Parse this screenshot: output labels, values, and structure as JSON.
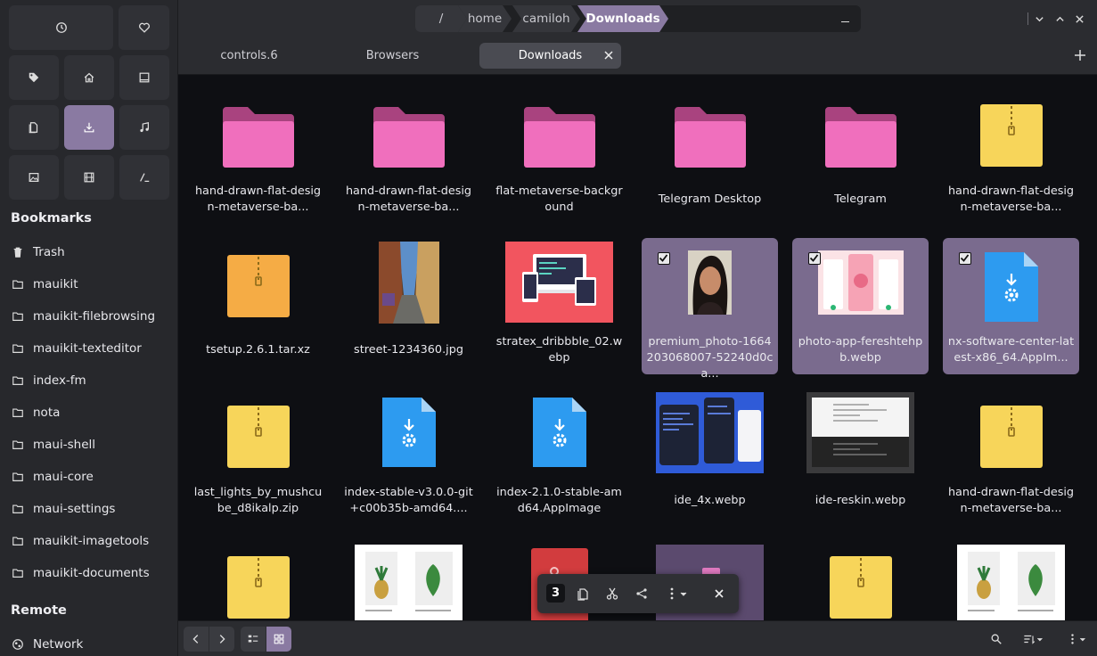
{
  "sidebar": {
    "quick_places": [
      {
        "icon": "clock-icon",
        "name": "recent"
      },
      {
        "icon": "heart-icon",
        "name": "favorites"
      },
      {
        "icon": "tag-icon",
        "name": "tags"
      },
      {
        "icon": "home-icon",
        "name": "home"
      },
      {
        "icon": "desktop-icon",
        "name": "desktop"
      },
      {
        "icon": "documents-icon",
        "name": "documents"
      },
      {
        "icon": "downloads-icon",
        "name": "downloads",
        "active": true
      },
      {
        "icon": "music-icon",
        "name": "music"
      },
      {
        "icon": "pictures-icon",
        "name": "pictures"
      },
      {
        "icon": "videos-icon",
        "name": "videos"
      },
      {
        "icon": "root-icon",
        "name": "root"
      }
    ],
    "bookmarks_title": "Bookmarks",
    "bookmarks": [
      {
        "label": "Trash",
        "icon": "trash-icon"
      },
      {
        "label": "mauikit",
        "icon": "folder-icon"
      },
      {
        "label": "mauikit-filebrowsing",
        "icon": "folder-icon"
      },
      {
        "label": "mauikit-texteditor",
        "icon": "folder-icon"
      },
      {
        "label": "index-fm",
        "icon": "folder-icon"
      },
      {
        "label": "nota",
        "icon": "folder-icon"
      },
      {
        "label": "maui-shell",
        "icon": "folder-icon"
      },
      {
        "label": "maui-core",
        "icon": "folder-icon"
      },
      {
        "label": "maui-settings",
        "icon": "folder-icon"
      },
      {
        "label": "mauikit-imagetools",
        "icon": "folder-icon"
      },
      {
        "label": "mauikit-documents",
        "icon": "folder-icon"
      }
    ],
    "remote_title": "Remote",
    "remote": [
      {
        "label": "Network",
        "icon": "network-icon"
      }
    ]
  },
  "pathbar": {
    "crumbs": [
      "/",
      "home",
      "camiloh",
      "Downloads"
    ]
  },
  "tabs": {
    "items": [
      {
        "label": "controls.6"
      },
      {
        "label": "Browsers"
      },
      {
        "label": "Downloads",
        "active": true
      }
    ]
  },
  "files": [
    {
      "label": "hand-drawn-flat-design-metaverse-ba...",
      "kind": "folder"
    },
    {
      "label": "hand-drawn-flat-design-metaverse-ba...",
      "kind": "folder"
    },
    {
      "label": "flat-metaverse-background",
      "kind": "folder"
    },
    {
      "label": "Telegram Desktop",
      "kind": "folder"
    },
    {
      "label": "Telegram",
      "kind": "folder"
    },
    {
      "label": "hand-drawn-flat-design-metaverse-ba...",
      "kind": "zip-yellow"
    },
    {
      "label": "tsetup.2.6.1.tar.xz",
      "kind": "zip-orange"
    },
    {
      "label": "street-1234360.jpg",
      "kind": "image-street"
    },
    {
      "label": "stratex_dribbble_02.webp",
      "kind": "image-stratex"
    },
    {
      "label": "premium_photo-1664203068007-52240d0ca...",
      "kind": "image-portrait",
      "selected": true
    },
    {
      "label": "photo-app-fereshtehpb.webp",
      "kind": "image-photoapp",
      "selected": true
    },
    {
      "label": "nx-software-center-latest-x86_64.AppIm...",
      "kind": "appimage",
      "selected": true
    },
    {
      "label": "last_lights_by_mushcube_d8ikalp.zip",
      "kind": "zip-yellow"
    },
    {
      "label": "index-stable-v3.0.0-git+c00b35b-amd64....",
      "kind": "appimage"
    },
    {
      "label": "index-2.1.0-stable-amd64.AppImage",
      "kind": "appimage"
    },
    {
      "label": "ide_4x.webp",
      "kind": "image-ide4x"
    },
    {
      "label": "ide-reskin.webp",
      "kind": "image-idereskin"
    },
    {
      "label": "hand-drawn-flat-design-metaverse-ba...",
      "kind": "zip-yellow"
    },
    {
      "label": "",
      "kind": "zip-yellow"
    },
    {
      "label": "",
      "kind": "image-plants"
    },
    {
      "label": "",
      "kind": "image-redbook"
    },
    {
      "label": "",
      "kind": "image-purple"
    },
    {
      "label": "",
      "kind": "zip-yellow"
    },
    {
      "label": "",
      "kind": "image-plants"
    }
  ],
  "selection": {
    "count": "3"
  },
  "colors": {
    "accent": "#8a7aa2",
    "folder": "#f06fbd",
    "zip_yellow": "#f7d55a",
    "zip_orange": "#f5ac45",
    "appimage": "#2d9bf0"
  }
}
